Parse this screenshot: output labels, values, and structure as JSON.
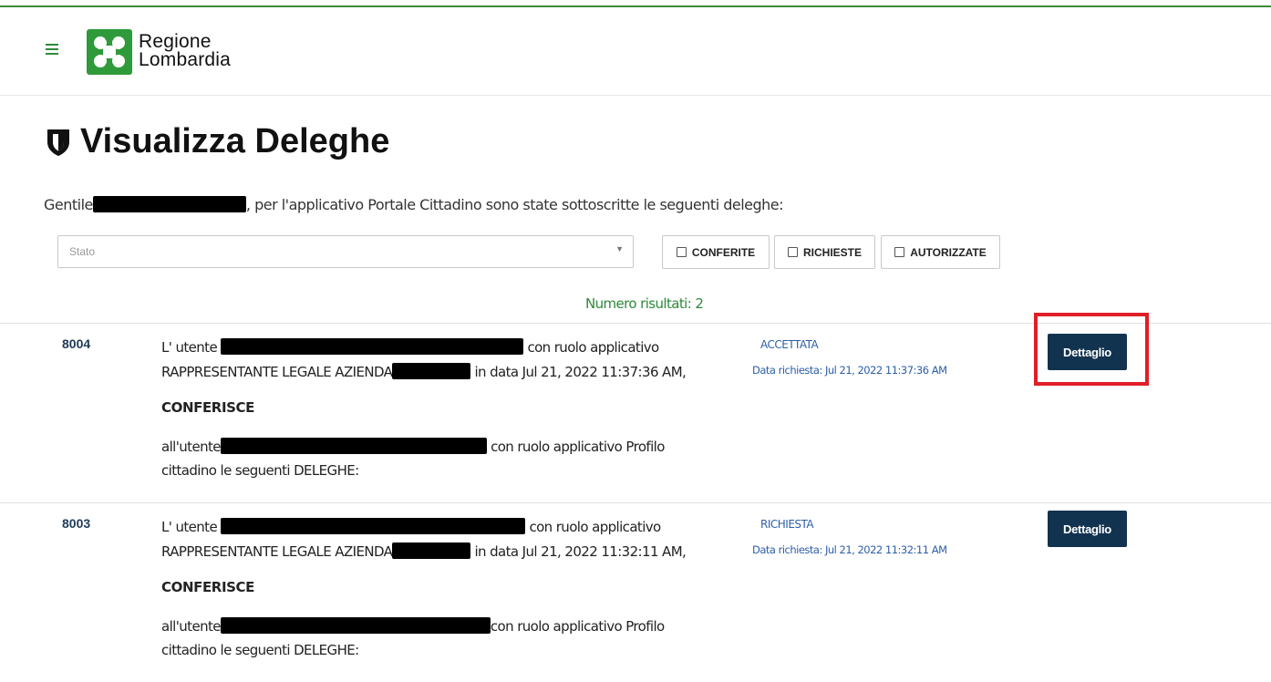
{
  "header": {
    "logo_line1": "Regione",
    "logo_line2": "Lombardia",
    "accent": "#2f9a3a"
  },
  "page": {
    "title": "Visualizza Deleghe",
    "intro_prefix": "Gentile",
    "intro_suffix": ", per l'applicativo Portale Cittadino sono state sottoscritte le seguenti deleghe:"
  },
  "filters": {
    "stato_placeholder": "Stato",
    "conferite": "CONFERITE",
    "richieste": "RICHIESTE",
    "autorizzate": "AUTORIZZATE"
  },
  "results": {
    "count_text": "Numero risultati: 2",
    "rows": [
      {
        "id": "8004",
        "line1_prefix": "L' utente",
        "line1_suffix": "con ruolo applicativo",
        "line2_prefix": "RAPPRESENTANTE LEGALE AZIENDA",
        "line2_suffix": "in data Jul 21, 2022 11:37:36 AM,",
        "action": "CONFERISCE",
        "line4_prefix": "all'utente",
        "line4_suffix": "con ruolo applicativo Profilo",
        "line5": "cittadino le seguenti DELEGHE:",
        "status": "ACCETTATA",
        "date": "Data richiesta: Jul 21, 2022 11:37:36 AM",
        "button": "Dettaglio"
      },
      {
        "id": "8003",
        "line1_prefix": "L' utente",
        "line1_suffix": "con ruolo applicativo",
        "line2_prefix": "RAPPRESENTANTE LEGALE AZIENDA",
        "line2_suffix": "in data Jul 21, 2022 11:32:11 AM,",
        "action": "CONFERISCE",
        "line4_prefix": "all'utente",
        "line4_suffix": "con ruolo applicativo Profilo",
        "line5": "cittadino le seguenti DELEGHE:",
        "status": "RICHIESTA",
        "date": "Data richiesta: Jul 21, 2022 11:32:11 AM",
        "button": "Dettaglio"
      }
    ]
  }
}
